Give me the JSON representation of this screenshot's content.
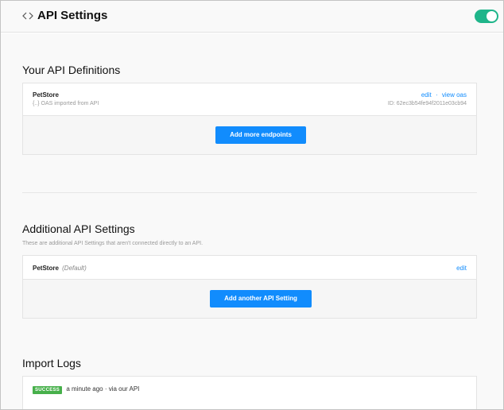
{
  "header": {
    "title": "API Settings",
    "toggle_on": true
  },
  "definitions": {
    "title": "Your API Definitions",
    "item": {
      "name": "PetStore",
      "source_icon": "{..}",
      "source": "OAS imported from API",
      "edit_label": "edit",
      "separator": "·",
      "view_label": "view oas",
      "id_text": "ID: 62ec3b54fe94f2011e03cb94"
    },
    "add_button": "Add more endpoints"
  },
  "additional": {
    "title": "Additional API Settings",
    "description": "These are additional API Settings that aren't connected directly to an API.",
    "item": {
      "name": "PetStore",
      "tag": "(Default)",
      "edit_label": "edit"
    },
    "add_button": "Add another API Setting"
  },
  "logs": {
    "title": "Import Logs",
    "entry": {
      "badge": "SUCCESS",
      "text": "a minute ago · via our API"
    }
  },
  "colors": {
    "accent": "#118cfd",
    "toggle": "#1fb58a",
    "success": "#47b04b"
  }
}
